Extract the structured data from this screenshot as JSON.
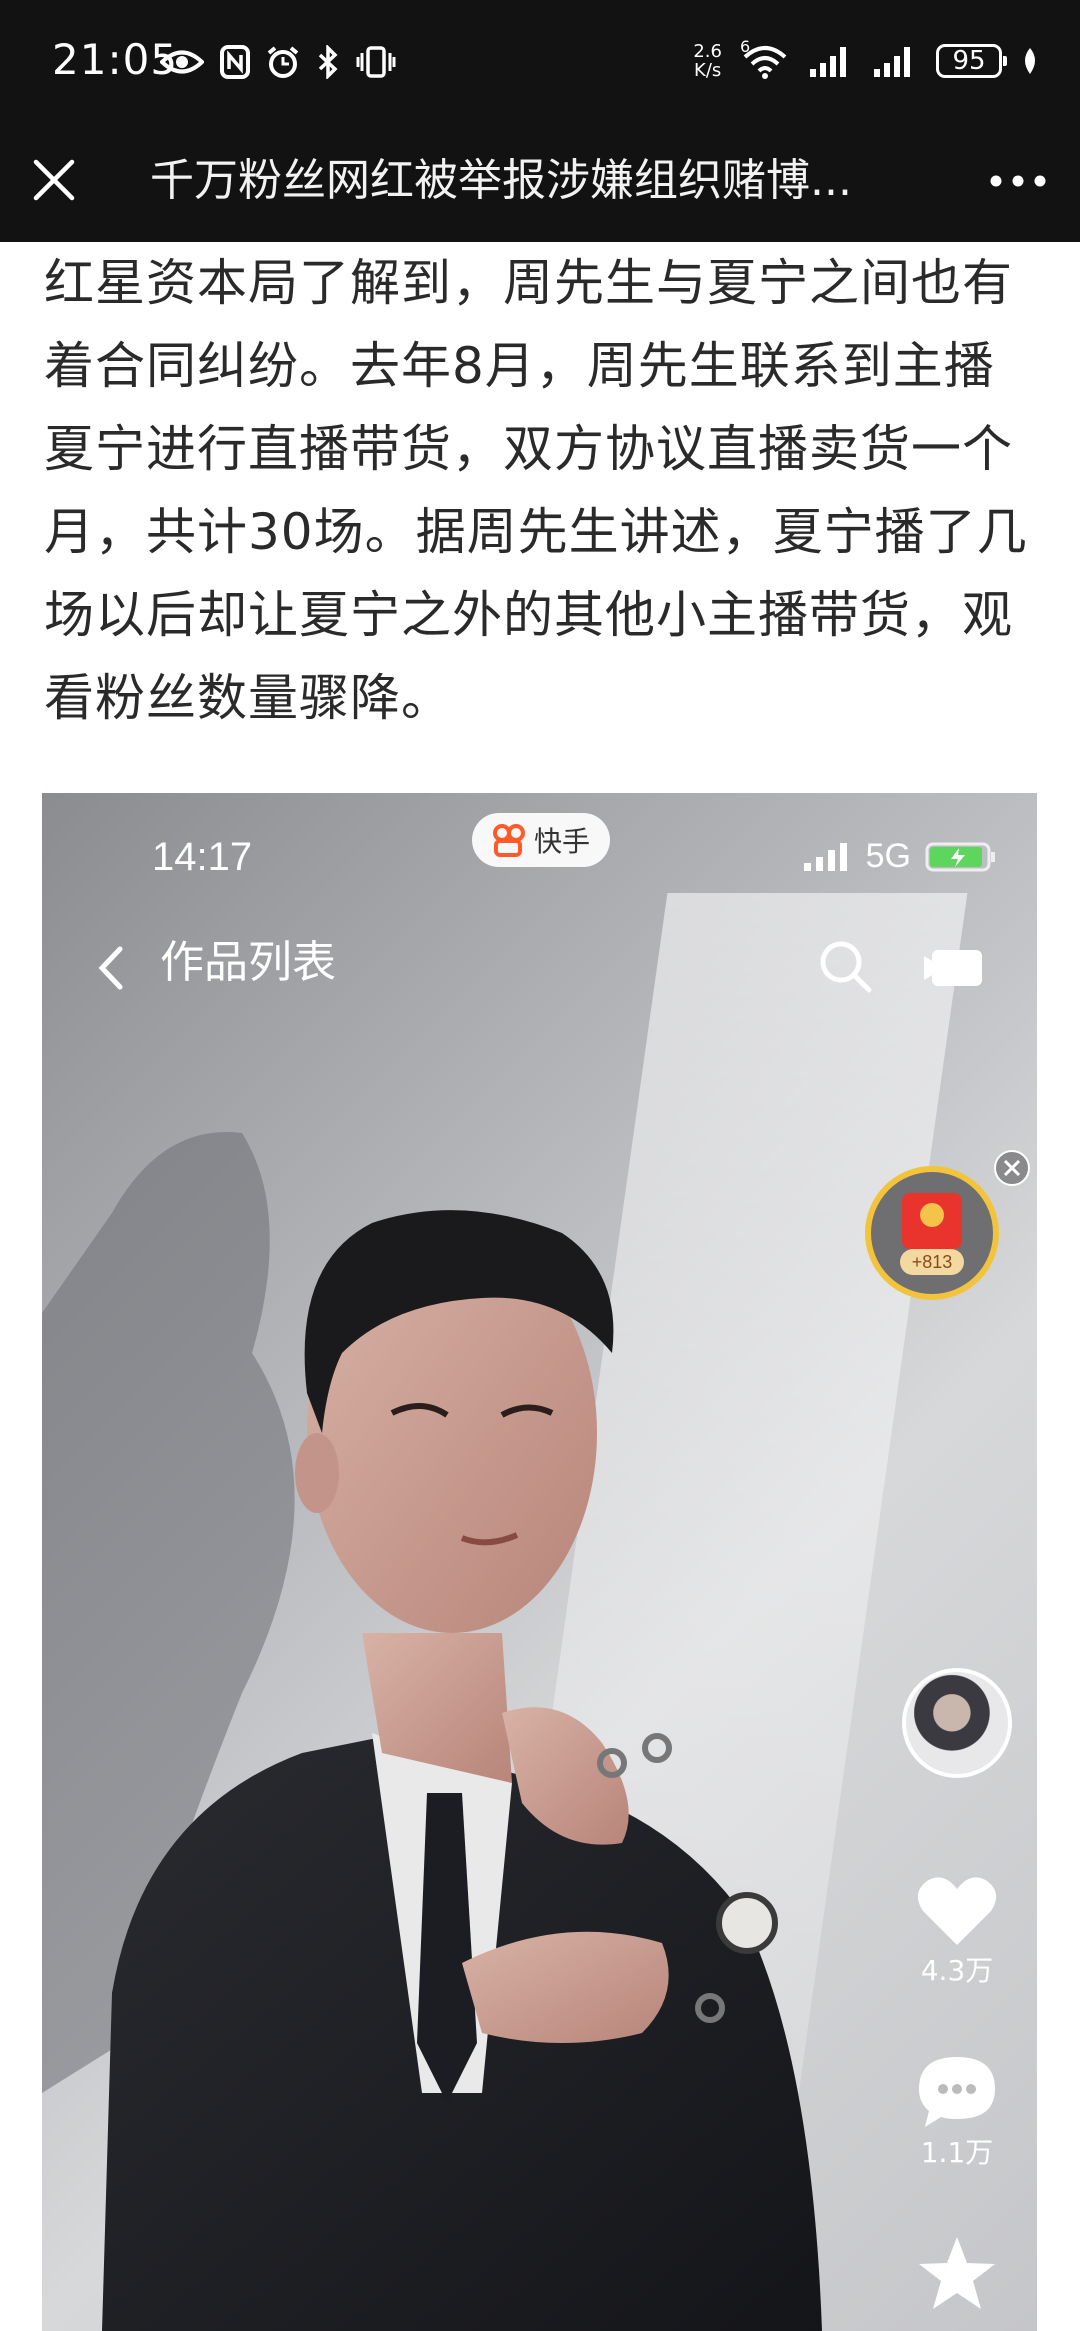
{
  "status_bar": {
    "time": "21:05",
    "net_speed_value": "2.6",
    "net_speed_unit": "K/s",
    "signal_label": "6",
    "battery": "95",
    "icons": [
      "eye-icon",
      "nfc-icon",
      "alarm-icon",
      "bluetooth-icon",
      "vibrate-icon",
      "wifi-icon",
      "signal-icon",
      "signal-icon",
      "battery-icon",
      "leaf-icon"
    ]
  },
  "nav": {
    "title": "千万粉丝网红被举报涉嫌组织赌博...",
    "close_icon": "close-icon",
    "more_icon": "more-icon"
  },
  "article": {
    "paragraph": "红星资本局了解到，周先生与夏宁之间也有着合同纠纷。去年8月，周先生联系到主播夏宁进行直播带货，双方协议直播卖货一个月，共计30场。据周先生讲述，夏宁播了几场以后却让夏宁之外的其他小主播带货，观看粉丝数量骤降。"
  },
  "embed": {
    "time": "14:17",
    "brand": "快手",
    "network": "5G",
    "page_title": "作品列表",
    "red_packet_value": "+813",
    "likes": "4.3万",
    "comments": "1.1万"
  }
}
